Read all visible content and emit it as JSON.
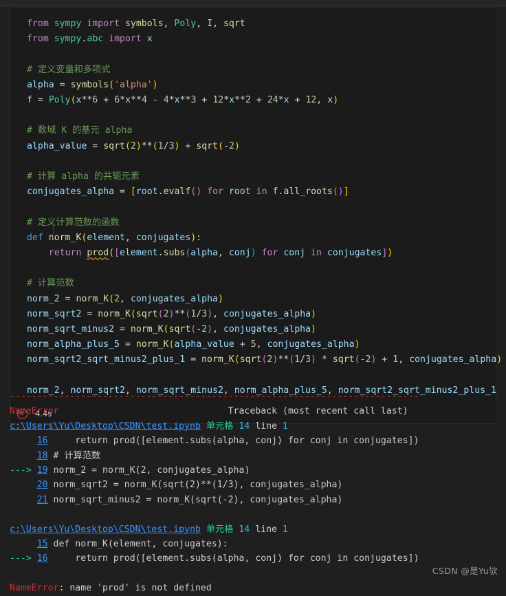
{
  "editor": {
    "theme": "dark-plus",
    "colors": {
      "background": "#1f1f1f",
      "cell_background": "#1b1b1b",
      "cell_border": "#2d2d30",
      "keyword": "#c586c0",
      "def_keyword": "#569cd6",
      "type": "#4ec9b0",
      "function": "#dcdcaa",
      "variable": "#9cdcfe",
      "number": "#b5cea8",
      "string": "#ce9178",
      "comment": "#6a9955",
      "bracket_1": "#ffd700",
      "bracket_2": "#da70d6",
      "bracket_3": "#179fff",
      "error_red": "#cd3131",
      "link_blue": "#3794ff",
      "traceback_green": "#23d18b",
      "traceback_cyan": "#29b8db",
      "squiggle_warning": "#cc8800"
    }
  },
  "cell": {
    "status": {
      "icon": "error-circle-x-icon",
      "execution_time": "4.4s"
    },
    "code_lines": [
      "from sympy import symbols, Poly, I, sqrt",
      "from sympy.abc import x",
      "",
      "# 定义变量和多项式",
      "alpha = symbols('alpha')",
      "f = Poly(x**6 + 6*x**4 - 4*x**3 + 12*x**2 + 24*x + 12, x)",
      "",
      "# 数域 K 的基元 alpha",
      "alpha_value = sqrt(2)**(1/3) + sqrt(-2)",
      "",
      "# 计算 alpha 的共轭元素",
      "conjugates_alpha = [root.evalf() for root in f.all_roots()]",
      "",
      "# 定义计算范数的函数",
      "def norm_K(element, conjugates):",
      "    return prod([element.subs(alpha, conj) for conj in conjugates])",
      "",
      "# 计算范数",
      "norm_2 = norm_K(2, conjugates_alpha)",
      "norm_sqrt2 = norm_K(sqrt(2)**(1/3), conjugates_alpha)",
      "norm_sqrt_minus2 = norm_K(sqrt(-2), conjugates_alpha)",
      "norm_alpha_plus_5 = norm_K(alpha_value + 5, conjugates_alpha)",
      "norm_sqrt2_sqrt_minus2_plus_1 = norm_K(sqrt(2)**(1/3) * sqrt(-2) + 1, conjugates_alpha)",
      "",
      "norm_2, norm_sqrt2, norm_sqrt_minus2, norm_alpha_plus_5, norm_sqrt2_sqrt_minus2_plus_1"
    ]
  },
  "output": {
    "separator": "---------------------------------------------------------------------------",
    "header": {
      "error_type": "NameError",
      "traceback_label": "Traceback (most recent call last)"
    },
    "frames": [
      {
        "file_path": "c:\\Users\\Yu\\Desktop\\CSDN\\test.ipynb",
        "cell_label": "单元格",
        "cell_number": "14",
        "line_word": "line",
        "line_number": "1",
        "lines": [
          {
            "arrow": "",
            "no": "16",
            "code": "    return prod([element.subs(alpha, conj) for conj in conjugates])"
          },
          {
            "arrow": "",
            "no": "18",
            "code": "# 计算范数"
          },
          {
            "arrow": "--->",
            "no": "19",
            "code": "norm_2 = norm_K(2, conjugates_alpha)"
          },
          {
            "arrow": "",
            "no": "20",
            "code": "norm_sqrt2 = norm_K(sqrt(2)**(1/3), conjugates_alpha)"
          },
          {
            "arrow": "",
            "no": "21",
            "code": "norm_sqrt_minus2 = norm_K(sqrt(-2), conjugates_alpha)"
          }
        ]
      },
      {
        "file_path": "c:\\Users\\Yu\\Desktop\\CSDN\\test.ipynb",
        "cell_label": "单元格",
        "cell_number": "14",
        "line_word": "line",
        "line_number": "1",
        "lines": [
          {
            "arrow": "",
            "no": "15",
            "code": "def norm_K(element, conjugates):"
          },
          {
            "arrow": "--->",
            "no": "16",
            "code": "    return prod([element.subs(alpha, conj) for conj in conjugates])"
          }
        ]
      }
    ],
    "final_error": {
      "type": "NameError",
      "message": ": name 'prod' is not defined"
    }
  },
  "watermark": {
    "text": "CSDN @是Yu欤"
  }
}
